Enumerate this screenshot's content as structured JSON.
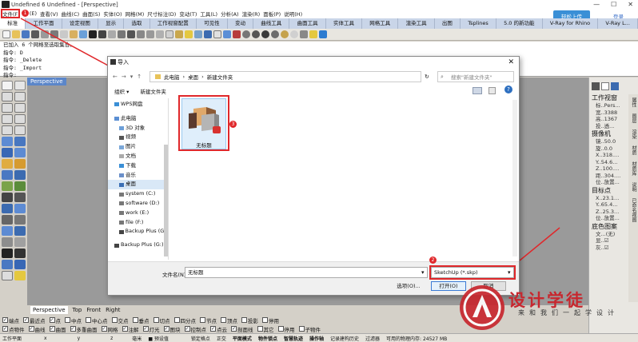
{
  "window": {
    "title": "Undefined 6 Undefined - [Perspective]"
  },
  "menubar": {
    "items": [
      "文件(F)",
      "(E)",
      "查看(V)",
      "曲线(C)",
      "曲面(S)",
      "实体(O)",
      "网格(M)",
      "尺寸标注(D)",
      "变动(T)",
      "工具(L)",
      "分析(A)",
      "渲染(R)",
      "面板(P)",
      "说明(H)"
    ]
  },
  "share_button": "轻松上传",
  "login_link": "登录",
  "tabs": [
    "标准",
    "工作平面",
    "设定视图",
    "显示",
    "选取",
    "工作视窗配置",
    "可见性",
    "变动",
    "曲线工具",
    "曲面工具",
    "实体工具",
    "网格工具",
    "渲染工具",
    "出图",
    "Tsplines",
    "5.0 的新功能",
    "V-Ray for Rhino",
    "V-Ray L..."
  ],
  "command_history": [
    "已加入 6 个网格至选取集合。",
    "指令: D",
    "指令: _Delete",
    "指令: _Import",
    "指令:"
  ],
  "viewport": {
    "label": "Perspective",
    "tabs": [
      "Perspective",
      "Top",
      "Front",
      "Right"
    ]
  },
  "right_panel": {
    "sections": [
      {
        "title": "工作视窗",
        "rows": [
          "标..Pers...",
          "宽..3388",
          "高..1367",
          "投..透..."
        ]
      },
      {
        "title": "摄像机",
        "rows": [
          "镜..50.0",
          "旋..0.0",
          "X..318....",
          "Y..54.6...",
          "Z..100....",
          "距..304....",
          "位..放置..."
        ]
      },
      {
        "title": "目标点",
        "rows": [
          "X..23.1...",
          "Y..65.4...",
          "Z..25.3...",
          "位..放置..."
        ]
      },
      {
        "title": "底色图案",
        "rows": [
          "文...(无)",
          "显..☑",
          "灰..☑"
        ]
      }
    ],
    "side_tabs": [
      "属性",
      "图层",
      "渲染",
      "材质",
      "材质库",
      "说明",
      "已命名视图"
    ]
  },
  "dialog": {
    "title": "导入",
    "path_parts": [
      "此电脑",
      "桌面",
      "新建文件夹"
    ],
    "search_placeholder": "搜索\"新建文件夹\"",
    "commands": [
      "组织 ▾",
      "新建文件夹"
    ],
    "nav_items": [
      "WPS网盘",
      "此电脑",
      "3D 对象",
      "视频",
      "图片",
      "文档",
      "下载",
      "音乐",
      "桌面",
      "system (C:)",
      "software (D:)",
      "work (E:)",
      "file (F:)",
      "Backup Plus (G:)",
      "Backup Plus (G:)"
    ],
    "selected_nav": "桌面",
    "file": {
      "name": "无标题"
    },
    "filename_label": "文件名(N):",
    "filename_value": "无标题",
    "filetype_value": "SketchUp (*.skp)",
    "tools_label": "选项(O)...",
    "open_label": "打开(O)",
    "cancel_label": "取消"
  },
  "annotations": {
    "step1": "1",
    "step2": "2",
    "step3": "3"
  },
  "osnap": {
    "row1": [
      "端点",
      "最近点",
      "点",
      "中点",
      "中心点",
      "交点",
      "垂点",
      "切点",
      "四分点",
      "节点",
      "顶点",
      "投影",
      "停用"
    ],
    "row1_checked": [
      true,
      true,
      true,
      false,
      false,
      false,
      false,
      false,
      false,
      false,
      false,
      false,
      false
    ],
    "row2": [
      "点物件",
      "曲线",
      "曲面",
      "多重曲面",
      "网格",
      "注解",
      "灯光",
      "图块",
      "控制点",
      "点云",
      "剖面线",
      "其它",
      "停用",
      "子物件"
    ],
    "row2_checked": [
      true,
      true,
      true,
      true,
      true,
      true,
      true,
      true,
      true,
      true,
      true,
      false,
      false,
      false
    ]
  },
  "status": [
    "工作平面",
    "x",
    "y",
    "z",
    "毫米",
    "■ 预设值",
    "锁定格点",
    "正交",
    "平面模式",
    "物件锁点",
    "智慧轨迹",
    "操作轴",
    "记录建构历史",
    "过滤器",
    "可用的物理内存: 24527 MB"
  ],
  "watermark": {
    "title": "设计学徒",
    "subtitle": "来和我们一起学设计"
  },
  "colors": {
    "accent": "#3a8fd6",
    "annotation_red": "#e0282b",
    "viewport_bg": "#9a9a9a",
    "brand_red": "#c7272e"
  }
}
